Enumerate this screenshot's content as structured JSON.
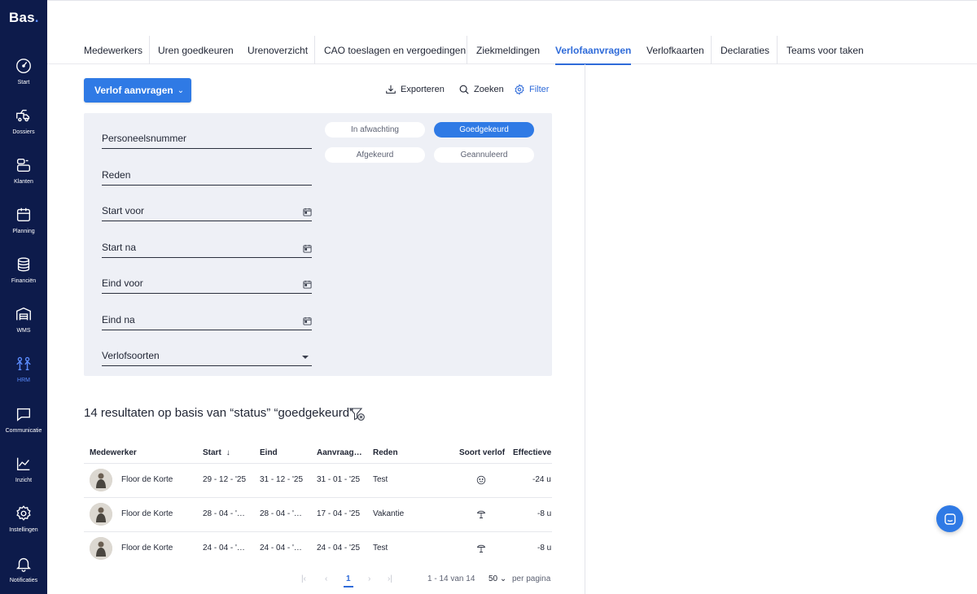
{
  "app": {
    "logo": "Bas",
    "logo_dot": "."
  },
  "sidebar": {
    "items": [
      {
        "label": "Start",
        "icon": "gauge-icon"
      },
      {
        "label": "Dossiers",
        "icon": "truck-icon"
      },
      {
        "label": "Klanten",
        "icon": "users-icon"
      },
      {
        "label": "Planning",
        "icon": "calendar-icon"
      },
      {
        "label": "Financiën",
        "icon": "coins-icon"
      },
      {
        "label": "WMS",
        "icon": "warehouse-icon"
      },
      {
        "label": "HRM",
        "icon": "people-icon",
        "active": true
      },
      {
        "label": "Communicatie",
        "icon": "chat-icon"
      },
      {
        "label": "Inzicht",
        "icon": "chart-icon"
      },
      {
        "label": "Instellingen",
        "icon": "gear-icon"
      },
      {
        "label": "Notificaties",
        "icon": "bell-icon"
      }
    ]
  },
  "tabs": [
    {
      "label": "Medewerkers"
    },
    {
      "label": "Uren goedkeuren"
    },
    {
      "label": "Urenoverzicht"
    },
    {
      "label": "CAO toeslagen en vergoedingen"
    },
    {
      "label": "Ziekmeldingen"
    },
    {
      "label": "Verlofaanvragen",
      "active": true
    },
    {
      "label": "Verlofkaarten"
    },
    {
      "label": "Declaraties"
    },
    {
      "label": "Teams voor taken"
    }
  ],
  "actions": {
    "primary": "Verlof aanvragen",
    "export": "Exporteren",
    "search": "Zoeken",
    "filter": "Filter"
  },
  "filters": {
    "fields": [
      {
        "label": "Personeelsnummer"
      },
      {
        "label": "Reden"
      },
      {
        "label": "Start voor"
      },
      {
        "label": "Start na"
      },
      {
        "label": "Eind voor"
      },
      {
        "label": "Eind na"
      },
      {
        "label": "Verlofsoorten"
      }
    ],
    "status": [
      {
        "label": "In afwachting",
        "selected": false
      },
      {
        "label": "Goedgekeurd",
        "selected": true
      },
      {
        "label": "Afgekeurd",
        "selected": false
      },
      {
        "label": "Geannuleerd",
        "selected": false
      }
    ]
  },
  "results": {
    "title": "14 resultaten op basis van “status” “goedgekeurd”"
  },
  "table": {
    "headers": [
      "Medewerker",
      "Start",
      "Eind",
      "Aanvraag…",
      "Reden",
      "Soort verlof",
      "Effectieve"
    ],
    "sort_arrow": "↓",
    "rows": [
      {
        "name": "Floor de Korte",
        "start": "29 - 12 - '25",
        "end": "31 - 12 - '25",
        "requested": "31 - 01 - '25",
        "reason": "Test",
        "type_icon": "smiley-icon",
        "effective": "-24 u"
      },
      {
        "name": "Floor de Korte",
        "start": "28 - 04 - '…",
        "end": "28 - 04 - '…",
        "requested": "17 - 04 - '25",
        "reason": "Vakantie",
        "type_icon": "umbrella-icon",
        "effective": "-8 u"
      },
      {
        "name": "Floor de Korte",
        "start": "24 - 04 - '…",
        "end": "24 - 04 - '…",
        "requested": "24 - 04 - '25",
        "reason": "Test",
        "type_icon": "umbrella-icon",
        "effective": "-8 u"
      }
    ]
  },
  "pagination": {
    "current": "1",
    "range": "1 - 14 van 14",
    "per_page": "50",
    "per_page_label": "per pagina"
  },
  "colors": {
    "sidebar": "#0d1b4b",
    "accent": "#2f7ae5",
    "active_tab": "#2f6bd9"
  }
}
